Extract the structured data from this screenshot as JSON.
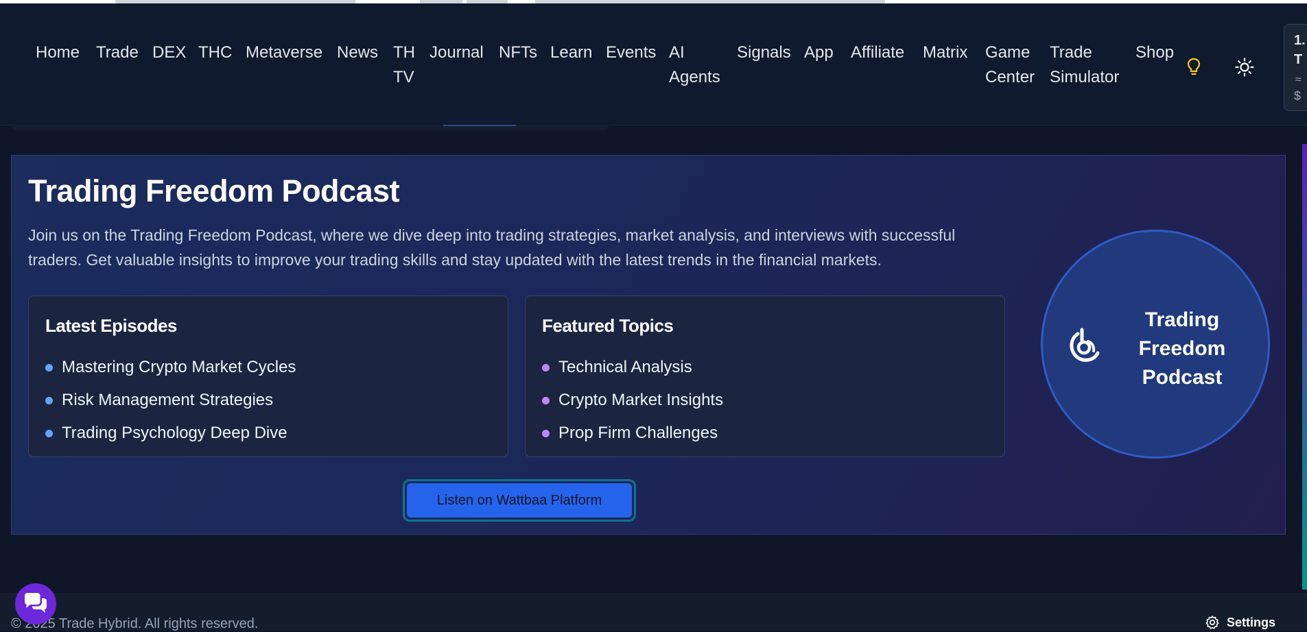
{
  "nav": {
    "items": [
      {
        "label": "Home"
      },
      {
        "label": "Trade"
      },
      {
        "label": "DEX"
      },
      {
        "label": "THC"
      },
      {
        "label": "Metaverse"
      },
      {
        "label": "News"
      },
      {
        "label": "TH\nTV"
      },
      {
        "label": "Journal"
      },
      {
        "label": "NFTs"
      },
      {
        "label": "Learn"
      },
      {
        "label": "Events"
      },
      {
        "label": "AI\nAgents"
      },
      {
        "label": "Signals"
      },
      {
        "label": "App"
      },
      {
        "label": "Affiliate"
      },
      {
        "label": "Matrix"
      },
      {
        "label": "Game\nCenter"
      },
      {
        "label": "Trade\nSimulator"
      },
      {
        "label": "Shop"
      }
    ],
    "icons": {
      "tips": "lightbulb-icon",
      "theme": "sun-icon"
    },
    "ticker": {
      "line1": "1.",
      "line2": "T",
      "line3": "≈",
      "line4": "$"
    }
  },
  "hero": {
    "title": "Trading Freedom Podcast",
    "description": "Join us on the Trading Freedom Podcast, where we dive deep into trading strategies, market analysis, and interviews with successful traders. Get valuable insights to improve your trading skills and stay updated with the latest trends in the financial markets.",
    "latest": {
      "title": "Latest Episodes",
      "items": [
        "Mastering Crypto Market Cycles",
        "Risk Management Strategies",
        "Trading Psychology Deep Dive"
      ],
      "bullet_color": "#60a5fa"
    },
    "featured": {
      "title": "Featured Topics",
      "items": [
        "Technical Analysis",
        "Crypto Market Insights",
        "Prop Firm Challenges"
      ],
      "bullet_color": "#c084fc"
    },
    "cta_label": "Listen on Wattbaa Platform",
    "badge": {
      "line1": "Trading",
      "line2": "Freedom",
      "line3": "Podcast",
      "icon": "podcast-icon"
    }
  },
  "footer": {
    "copyright": "© 2025 Trade Hybrid. All rights reserved.",
    "settings_label": "Settings"
  },
  "colors": {
    "accent": "#2563eb",
    "chat": "#6d28d9",
    "bulb": "#facc15"
  }
}
